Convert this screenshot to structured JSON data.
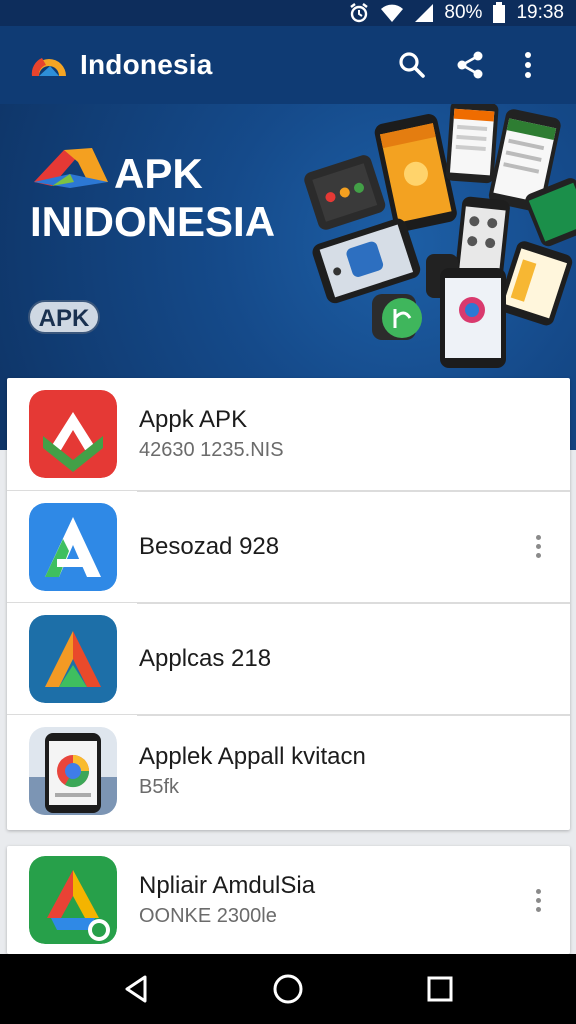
{
  "status_bar": {
    "battery": "80%",
    "time": "19:38",
    "icons": [
      "alarm-icon",
      "wifi-icon",
      "signal-icon",
      "battery-icon"
    ]
  },
  "app_bar": {
    "title": "Indonesia",
    "actions": [
      "search-icon",
      "share-icon",
      "more-vert-icon"
    ]
  },
  "banner": {
    "title_line1": "APK",
    "title_line2": "INIDONESIA",
    "badge": "APK"
  },
  "apps": [
    {
      "title": "Appk APK",
      "subtitle": "42630 1235.NIS",
      "icon": "red-green-arrow-icon",
      "menu": false
    },
    {
      "title": "Besozad 928",
      "subtitle": "",
      "icon": "blue-a-icon",
      "menu": true
    },
    {
      "title": "Applcas 218",
      "subtitle": "",
      "icon": "teal-a-icon",
      "menu": false
    },
    {
      "title": "Applek Appall kvitacn",
      "subtitle": "B5fk",
      "icon": "phone-browser-icon",
      "menu": false
    }
  ],
  "apps_section2": [
    {
      "title": "Npliair AmdulSia",
      "subtitle": "OONKE 2300le",
      "icon": "green-drive-icon",
      "menu": true
    }
  ],
  "nav": [
    "back-icon",
    "home-icon",
    "recents-icon"
  ],
  "colors": {
    "app_bar": "#0f3b74",
    "status_bar": "#0d2d5c",
    "banner": "#154a8a",
    "card_bg": "#ffffff"
  }
}
